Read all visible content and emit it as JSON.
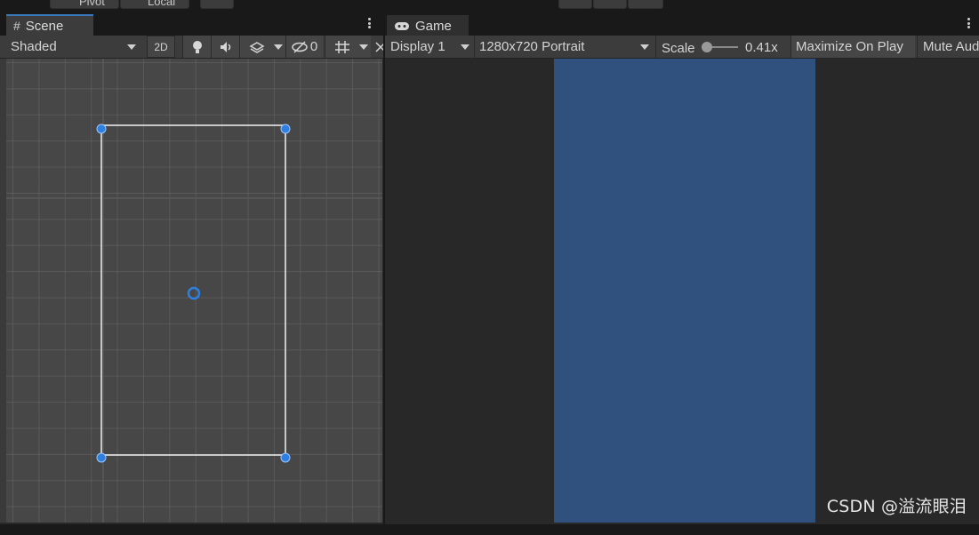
{
  "top_toolbar": {
    "pivot_label": "Pivot",
    "local_label": "Local"
  },
  "scene_panel": {
    "tab_label": "Scene",
    "shading_mode": "Shaded",
    "mode_2d_label": "2D",
    "hidden_objects_count": "0",
    "icons": [
      "hash-icon",
      "lightbulb-icon",
      "audio-icon",
      "effects-icon",
      "visibility-icon",
      "grid-icon",
      "gizmos-icon"
    ]
  },
  "game_panel": {
    "tab_label": "Game",
    "display_label": "Display 1",
    "resolution_label": "1280x720 Portrait",
    "scale_label": "Scale",
    "scale_value": "0.41x",
    "scale_fraction": 0.0,
    "maximize_label": "Maximize On Play",
    "mute_label": "Mute Aud",
    "canvas_color": "#30507d"
  },
  "watermark": "CSDN @溢流眼泪",
  "colors": {
    "accent_blue": "#3a79bb",
    "handle_blue": "#2f7fe0",
    "panel_bg": "#282828",
    "toolbar_bg": "#3c3c3c"
  }
}
